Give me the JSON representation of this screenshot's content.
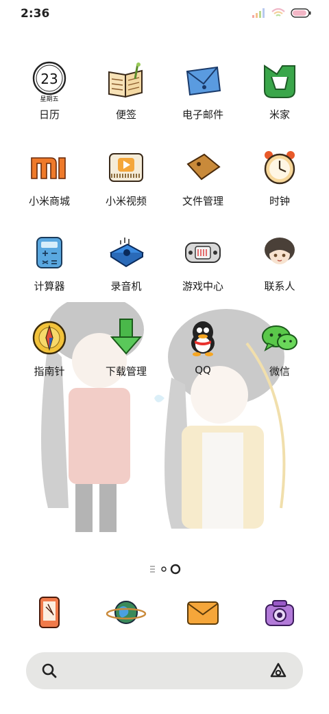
{
  "status": {
    "time": "2:36"
  },
  "apps": [
    {
      "label": "日历",
      "icon": "calendar-icon",
      "date": "23",
      "weekday": "星期五"
    },
    {
      "label": "便签",
      "icon": "notes-icon"
    },
    {
      "label": "电子邮件",
      "icon": "email-icon"
    },
    {
      "label": "米家",
      "icon": "mijia-icon"
    },
    {
      "label": "小米商城",
      "icon": "mi-store-icon"
    },
    {
      "label": "小米视频",
      "icon": "video-icon"
    },
    {
      "label": "文件管理",
      "icon": "file-manager-icon"
    },
    {
      "label": "时钟",
      "icon": "clock-icon"
    },
    {
      "label": "计算器",
      "icon": "calculator-icon"
    },
    {
      "label": "录音机",
      "icon": "recorder-icon"
    },
    {
      "label": "游戏中心",
      "icon": "game-center-icon"
    },
    {
      "label": "联系人",
      "icon": "contacts-icon"
    },
    {
      "label": "指南针",
      "icon": "compass-icon"
    },
    {
      "label": "下载管理",
      "icon": "download-icon"
    },
    {
      "label": "QQ",
      "icon": "qq-icon"
    },
    {
      "label": "微信",
      "icon": "wechat-icon"
    }
  ],
  "dock": [
    {
      "icon": "phone-icon"
    },
    {
      "icon": "browser-icon"
    },
    {
      "icon": "messages-icon"
    },
    {
      "icon": "camera-icon"
    }
  ],
  "pager": {
    "pages": 2,
    "current": 2
  },
  "colors": {
    "label": "#1a1a1a",
    "search_bg": "#e6e6e4"
  }
}
